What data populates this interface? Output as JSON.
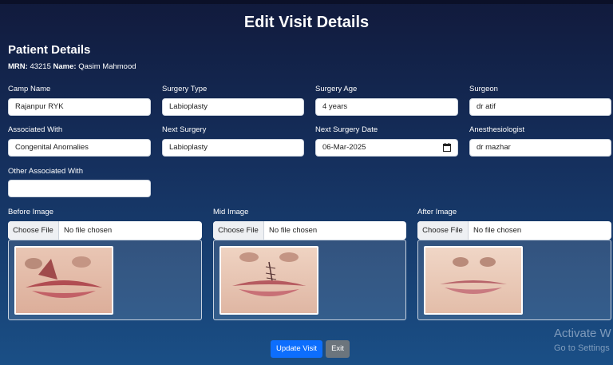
{
  "page": {
    "title": "Edit Visit Details"
  },
  "patient": {
    "heading": "Patient Details",
    "mrn_label": "MRN:",
    "mrn": "43215",
    "name_label": "Name:",
    "name": "Qasim Mahmood"
  },
  "fields": {
    "camp_name": {
      "label": "Camp Name",
      "value": "Rajanpur RYK"
    },
    "surgery_type": {
      "label": "Surgery Type",
      "value": "Labioplasty"
    },
    "surgery_age": {
      "label": "Surgery Age",
      "value": "4 years"
    },
    "surgeon": {
      "label": "Surgeon",
      "value": "dr atif"
    },
    "associated_with": {
      "label": "Associated With",
      "value": "Congenital Anomalies"
    },
    "next_surgery": {
      "label": "Next Surgery",
      "value": "Labioplasty"
    },
    "next_surgery_date": {
      "label": "Next Surgery Date",
      "value": "06-Mar-2025"
    },
    "anesthesiologist": {
      "label": "Anesthesiologist",
      "value": "dr mazhar"
    },
    "other_associated_with": {
      "label": "Other Associated With",
      "value": ""
    }
  },
  "images": {
    "before": {
      "label": "Before Image",
      "choose": "Choose File",
      "status": "No file chosen"
    },
    "mid": {
      "label": "Mid Image",
      "choose": "Choose File",
      "status": "No file chosen"
    },
    "after": {
      "label": "After Image",
      "choose": "Choose File",
      "status": "No file chosen"
    }
  },
  "actions": {
    "update": "Update Visit",
    "exit": "Exit"
  },
  "watermark": {
    "line1": "Activate W",
    "line2": "Go to Settings"
  },
  "colors": {
    "primary": "#0d6efd",
    "secondary": "#6c757d"
  },
  "icons": {
    "date_picker": "calendar-icon"
  }
}
